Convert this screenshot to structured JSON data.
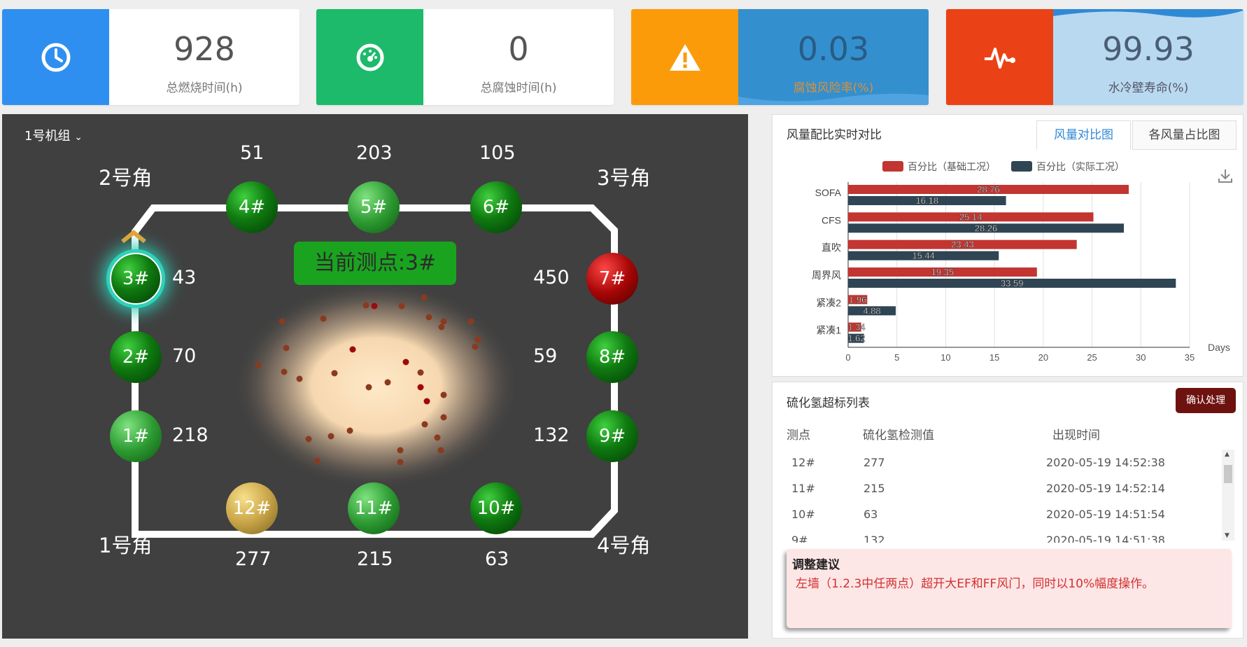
{
  "stats": [
    {
      "value": "928",
      "label": "总燃烧时间(h)",
      "icon": "clock-icon",
      "color": "#2f8ff0"
    },
    {
      "value": "0",
      "label": "总腐蚀时间(h)",
      "icon": "gauge-icon",
      "color": "#1cba6a"
    },
    {
      "value": "0.03",
      "label": "腐蚀风险率(%)",
      "icon": "warning-icon",
      "color": "#fb9b0a"
    },
    {
      "value": "99.93",
      "label": "水冷壁寿命(%)",
      "icon": "pulse-icon",
      "color": "#ea4216"
    }
  ],
  "boiler": {
    "unit_select": "1号机组",
    "current_point": "当前测点:3#",
    "corners": {
      "c2": "2号角",
      "c3": "3号角",
      "c1": "1号角",
      "c4": "4号角"
    },
    "points": {
      "p1": {
        "label": "1#",
        "value": "218"
      },
      "p2": {
        "label": "2#",
        "value": "70"
      },
      "p3": {
        "label": "3#",
        "value": "43"
      },
      "p4": {
        "label": "4#",
        "value": "51"
      },
      "p5": {
        "label": "5#",
        "value": "203"
      },
      "p6": {
        "label": "6#",
        "value": "105"
      },
      "p7": {
        "label": "7#",
        "value": "450"
      },
      "p8": {
        "label": "8#",
        "value": "59"
      },
      "p9": {
        "label": "9#",
        "value": "132"
      },
      "p10": {
        "label": "10#",
        "value": "63"
      },
      "p11": {
        "label": "11#",
        "value": "215"
      },
      "p12": {
        "label": "12#",
        "value": "277"
      }
    }
  },
  "air_panel": {
    "title": "风量配比实时对比",
    "tabs": [
      "风量对比图",
      "各风量占比图"
    ],
    "active_tab": 0
  },
  "chart_data": {
    "type": "bar",
    "orientation": "horizontal",
    "categories": [
      "SOFA",
      "CFS",
      "直吹",
      "周界风",
      "紧凑2",
      "紧凑1"
    ],
    "series": [
      {
        "name": "百分比（基础工况）",
        "color": "#c23531",
        "values": [
          28.76,
          25.14,
          23.43,
          19.35,
          1.96,
          1.34
        ]
      },
      {
        "name": "百分比（实际工况）",
        "color": "#2f4554",
        "values": [
          16.18,
          28.26,
          15.44,
          33.59,
          4.88,
          1.62
        ]
      }
    ],
    "xlim": [
      0,
      35
    ],
    "xticks": [
      0,
      5,
      10,
      15,
      20,
      25,
      30,
      35
    ],
    "xlabel": "Days",
    "legend_position": "top",
    "grid": true
  },
  "h2s_panel": {
    "title": "硫化氢超标列表",
    "confirm_label": "确认处理",
    "columns": [
      "测点",
      "硫化氢检测值",
      "出现时间"
    ],
    "rows": [
      [
        "12#",
        "277",
        "2020-05-19 14:52:38"
      ],
      [
        "11#",
        "215",
        "2020-05-19 14:52:14"
      ],
      [
        "10#",
        "63",
        "2020-05-19 14:51:54"
      ],
      [
        "9#",
        "132",
        "2020-05-19 14:51:38"
      ]
    ]
  },
  "suggestion": {
    "title": "调整建议",
    "content": "左墙（1.2.3中任两点）超开大EF和FF风门，同时以10%幅度操作。"
  }
}
